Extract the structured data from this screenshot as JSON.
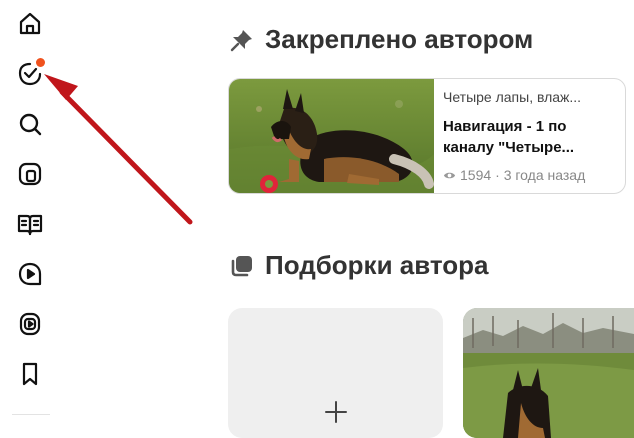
{
  "sidebar": {
    "items": [
      {
        "name": "home-icon"
      },
      {
        "name": "subscriptions-icon",
        "has_badge": true
      },
      {
        "name": "search-icon"
      },
      {
        "name": "shorts-icon"
      },
      {
        "name": "articles-icon"
      },
      {
        "name": "video-icon"
      },
      {
        "name": "live-icon"
      },
      {
        "name": "bookmark-icon"
      }
    ],
    "badge_color": "#f0521e"
  },
  "pinned": {
    "heading": "Закреплено автором",
    "card": {
      "channel": "Четыре лапы, влаж...",
      "title_line1": "Навигация - 1 по",
      "title_line2": "каналу \"Четыре...",
      "views": "1594",
      "age": "· 3 года назад"
    }
  },
  "collections": {
    "heading": "Подборки автора",
    "add_icon": "plus-icon"
  },
  "annotation": {
    "arrow_color": "#c0161b"
  }
}
